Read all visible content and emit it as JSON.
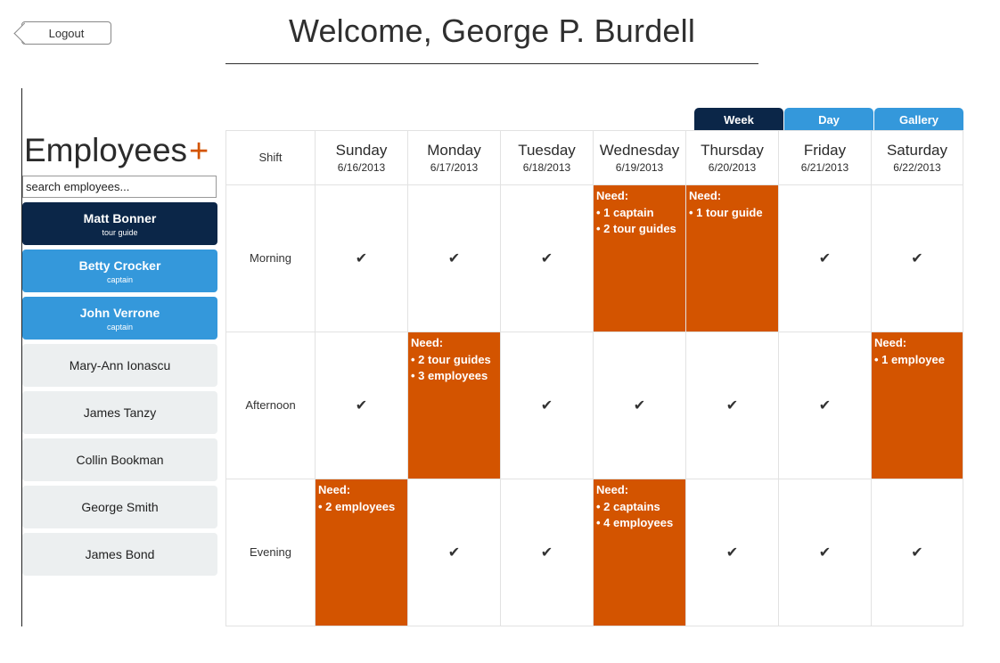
{
  "header": {
    "logout_label": "Logout",
    "welcome": "Welcome, George P. Burdell"
  },
  "employees": {
    "title": "Employees",
    "add_symbol": "+",
    "search_placeholder": "search employees...",
    "items": [
      {
        "name": "Matt Bonner",
        "role": "tour guide",
        "state": "selected"
      },
      {
        "name": "Betty Crocker",
        "role": "captain",
        "state": "highlighted"
      },
      {
        "name": "John Verrone",
        "role": "captain",
        "state": "highlighted"
      },
      {
        "name": "Mary-Ann Ionascu",
        "role": "",
        "state": "normal"
      },
      {
        "name": "James Tanzy",
        "role": "",
        "state": "normal"
      },
      {
        "name": "Collin Bookman",
        "role": "",
        "state": "normal"
      },
      {
        "name": "George Smith",
        "role": "",
        "state": "normal"
      },
      {
        "name": "James Bond",
        "role": "",
        "state": "normal"
      }
    ]
  },
  "view_tabs": [
    {
      "label": "Week",
      "active": true
    },
    {
      "label": "Day",
      "active": false
    },
    {
      "label": "Gallery",
      "active": false
    }
  ],
  "schedule": {
    "shift_header": "Shift",
    "days": [
      {
        "name": "Sunday",
        "date": "6/16/2013"
      },
      {
        "name": "Monday",
        "date": "6/17/2013"
      },
      {
        "name": "Tuesday",
        "date": "6/18/2013"
      },
      {
        "name": "Wednesday",
        "date": "6/19/2013"
      },
      {
        "name": "Thursday",
        "date": "6/20/2013"
      },
      {
        "name": "Friday",
        "date": "6/21/2013"
      },
      {
        "name": "Saturday",
        "date": "6/22/2013"
      }
    ],
    "need_label": "Need:",
    "check_glyph": "✔",
    "shifts": [
      {
        "name": "Morning",
        "cells": [
          {
            "filled": true
          },
          {
            "filled": true
          },
          {
            "filled": true
          },
          {
            "filled": false,
            "needs": [
              "1 captain",
              "2 tour guides"
            ]
          },
          {
            "filled": false,
            "needs": [
              "1 tour guide"
            ]
          },
          {
            "filled": true
          },
          {
            "filled": true
          }
        ]
      },
      {
        "name": "Afternoon",
        "cells": [
          {
            "filled": true
          },
          {
            "filled": false,
            "needs": [
              "2 tour guides",
              "3 employees"
            ]
          },
          {
            "filled": true
          },
          {
            "filled": true
          },
          {
            "filled": true
          },
          {
            "filled": true
          },
          {
            "filled": false,
            "needs": [
              "1 employee"
            ]
          }
        ]
      },
      {
        "name": "Evening",
        "cells": [
          {
            "filled": false,
            "needs": [
              "2 employees"
            ]
          },
          {
            "filled": true
          },
          {
            "filled": true
          },
          {
            "filled": false,
            "needs": [
              "2 captains",
              "4 employees"
            ]
          },
          {
            "filled": true
          },
          {
            "filled": true
          },
          {
            "filled": true
          }
        ]
      }
    ]
  },
  "colors": {
    "need": "#d35400",
    "selected": "#0b2648",
    "highlight": "#3498db",
    "card": "#eceff0"
  }
}
